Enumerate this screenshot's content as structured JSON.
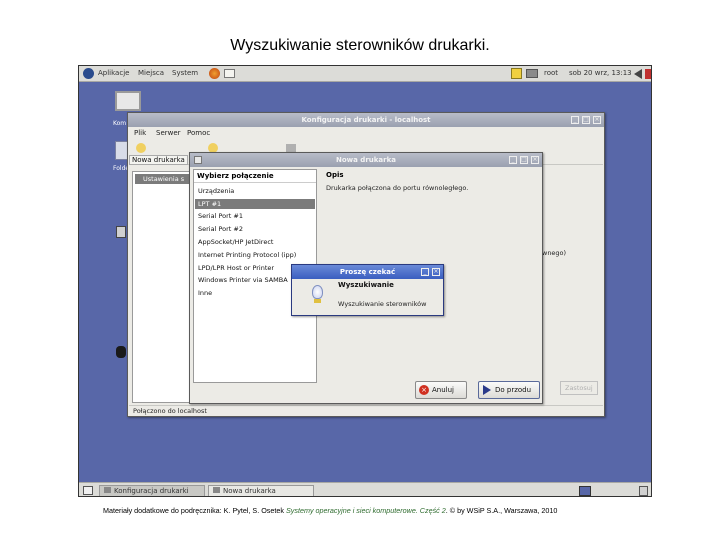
{
  "slide_title": "Wyszukiwanie sterowników drukarki.",
  "footer": {
    "prefix": "Materiały dodatkowe do podręcznika: K. Pytel, S. Osetek",
    "book": "Systemy operacyjne i sieci komputerowe. Część 2",
    "suffix": ". © by WSiP S.A., Warszawa, 2010"
  },
  "top_panel": {
    "menus": [
      "Aplikacje",
      "Miejsca",
      "System"
    ],
    "user": "root",
    "clock": "sob 20 wrz, 13:13"
  },
  "desktop": {
    "icons": [
      {
        "label": "Kom"
      },
      {
        "label": "Folder"
      }
    ]
  },
  "printer_config": {
    "title": "Konfiguracja drukarki - localhost",
    "menus": [
      "Plik",
      "Serwer",
      "Pomoc"
    ],
    "new_printer_tab": "Nowa drukarka",
    "left_list_item": "Ustawienia s",
    "right_fragment": "wnego)",
    "status": "Połączono do localhost",
    "dim_button": "Zastosuj"
  },
  "new_printer": {
    "title": "Nowa drukarka",
    "connection_header": "Wybierz połączenie",
    "description_header": "Opis",
    "description_text": "Drukarka połączona do portu równoległego.",
    "connections": [
      "Urządzenia",
      "LPT #1",
      "Serial Port #1",
      "Serial Port #2",
      "AppSocket/HP JetDirect",
      "Internet Printing Protocol (ipp)",
      "LPD/LPR Host or Printer",
      "Windows Printer via SAMBA",
      "Inne"
    ],
    "selected_index": 1,
    "cancel": "Anuluj",
    "forward": "Do przodu"
  },
  "wait_dialog": {
    "title": "Proszę czekać",
    "heading": "Wyszukiwanie",
    "message": "Wyszukiwanie sterowników"
  },
  "taskbar": {
    "tasks": [
      "Konfiguracja drukarki",
      "Nowa drukarka"
    ]
  },
  "colors": {
    "desktop": "#5867a8",
    "active_title": "#3a5ec0",
    "selection": "#7b7b7b"
  }
}
